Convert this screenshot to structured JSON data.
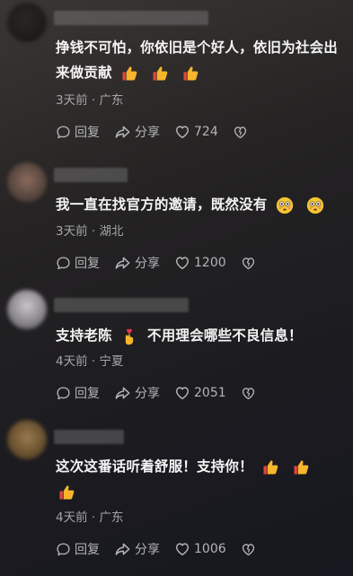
{
  "comments": [
    {
      "text_line1": "挣钱不可怕，你依旧是个好人，依旧为社会出",
      "text_line2": "来做贡献",
      "emojis": [
        "thumbs-up-emoji",
        "thumbs-up-emoji",
        "thumbs-up-emoji"
      ],
      "meta": "3天前 · 广东",
      "reply": "回复",
      "share": "分享",
      "likes": "724"
    },
    {
      "text_line1": "我一直在找官方的邀请，既然没有",
      "emojis": [
        "flushed-face-emoji",
        "flushed-face-emoji"
      ],
      "meta": "3天前 · 湖北",
      "reply": "回复",
      "share": "分享",
      "likes": "1200"
    },
    {
      "text_prefix": "支持老陈",
      "text_suffix": "不用理会哪些不良信息！",
      "emojis": [
        "finger-heart-emoji"
      ],
      "meta": "4天前 · 宁夏",
      "reply": "回复",
      "share": "分享",
      "likes": "2051"
    },
    {
      "text_line1": "这次这番话听着舒服！支持你！",
      "emojis": [
        "thumbs-up-emoji",
        "thumbs-up-emoji",
        "thumbs-up-emoji"
      ],
      "meta": "4天前 · 广东",
      "reply": "回复",
      "share": "分享",
      "likes": "1006"
    }
  ],
  "colors": {
    "text": "#f4f4f4",
    "meta": "#a5a5a8",
    "action": "#b4b4b8",
    "thumb": "#f5a623"
  }
}
